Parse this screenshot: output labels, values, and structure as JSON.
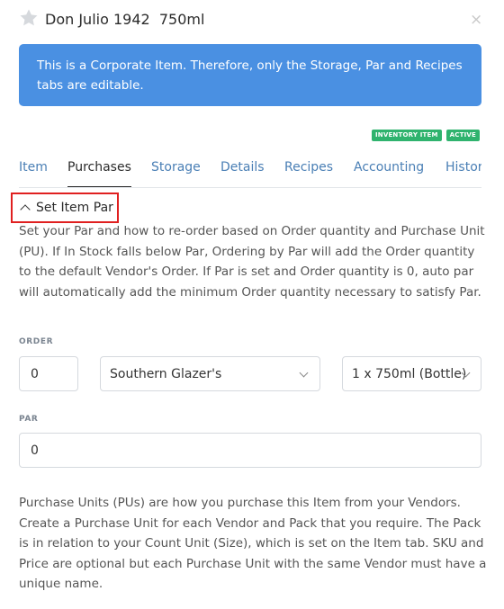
{
  "header": {
    "title": "Don Julio 1942  750ml",
    "star_icon": "star-icon",
    "close_icon": "close-icon",
    "close_glyph": "×"
  },
  "banner": {
    "text": "This is a Corporate Item. Therefore, only the Storage, Par and Recipes tabs are editable.",
    "color": "#4a90e2"
  },
  "badges": [
    "INVENTORY ITEM",
    "ACTIVE"
  ],
  "badge_color": "#2fb36e",
  "tabs": [
    {
      "label": "Item"
    },
    {
      "label": "Purchases"
    },
    {
      "label": "Storage"
    },
    {
      "label": "Details"
    },
    {
      "label": "Recipes"
    },
    {
      "label": "Accounting"
    },
    {
      "label": "Histor"
    }
  ],
  "active_tab": "Purchases",
  "section": {
    "label": "Set Item Par",
    "description": "Set your Par and how to re-order based on Order quantity and Purchase Unit (PU). If In Stock falls below Par, Ordering by Par will add the Order quantity to the default Vendor's Order. If Par is set and Order quantity is 0, auto par will automatically add the minimum Order quantity necessary to satisfy Par."
  },
  "order": {
    "label": "ORDER",
    "quantity": "0",
    "vendor": "Southern Glazer's",
    "unit": "1 x 750ml (Bottle)"
  },
  "par": {
    "label": "PAR",
    "value": "0"
  },
  "purchase_units_text": "Purchase Units (PUs) are how you purchase this Item from your Vendors. Create a Purchase Unit for each Vendor and Pack that you require. The Pack is in relation to your Count Unit (Size), which is set on the Item tab. SKU and Price are optional but each Purchase Unit with the same Vendor must have a unique name."
}
